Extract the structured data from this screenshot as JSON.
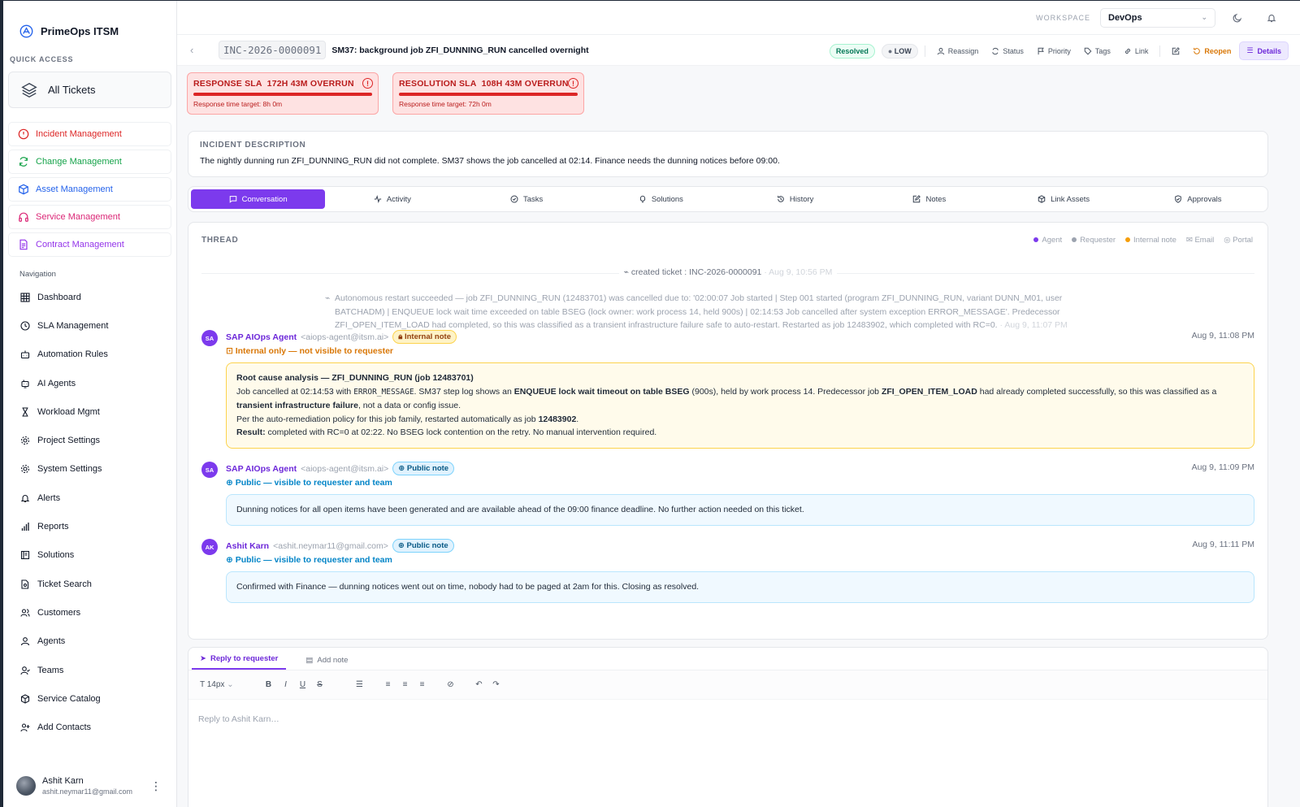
{
  "app": {
    "name": "PrimeOps ITSM"
  },
  "quick_access": {
    "label": "QUICK ACCESS",
    "all_tickets": "All Tickets"
  },
  "modules": [
    {
      "label": "Incident Management",
      "color": "#dc2626"
    },
    {
      "label": "Change Management",
      "color": "#16a34a"
    },
    {
      "label": "Asset Management",
      "color": "#2563eb"
    },
    {
      "label": "Service Management",
      "color": "#db2777"
    },
    {
      "label": "Contract Management",
      "color": "#9333ea"
    }
  ],
  "nav": {
    "label": "Navigation",
    "items": [
      "Dashboard",
      "SLA Management",
      "Automation Rules",
      "AI Agents",
      "Workload Mgmt",
      "Project Settings",
      "System Settings",
      "Alerts",
      "Reports",
      "Solutions",
      "Ticket Search",
      "Customers",
      "Agents",
      "Teams",
      "Service Catalog",
      "Add Contacts"
    ]
  },
  "user": {
    "name": "Ashit Karn",
    "email": "ashit.neymar11@gmail.com"
  },
  "topbar": {
    "workspace_label": "WORKSPACE",
    "workspace_value": "DevOps"
  },
  "ticket": {
    "id": "INC-2026-0000091",
    "title": "SM37: background job ZFI_DUNNING_RUN cancelled overnight",
    "status": "Resolved",
    "priority": "LOW"
  },
  "actions": {
    "reassign": "Reassign",
    "status": "Status",
    "priority": "Priority",
    "tags": "Tags",
    "link": "Link",
    "reopen": "Reopen",
    "details": "Details"
  },
  "sla": {
    "response": {
      "label": "RESPONSE SLA",
      "overrun": "172H 43M OVERRUN",
      "target": "Response time target: 8h 0m"
    },
    "resolution": {
      "label": "RESOLUTION SLA",
      "overrun": "108H 43M OVERRUN",
      "target": "Response time target: 72h 0m"
    }
  },
  "description": {
    "label": "INCIDENT DESCRIPTION",
    "text": "The nightly dunning run ZFI_DUNNING_RUN did not complete. SM37 shows the job cancelled at 02:14. Finance needs the dunning notices before 09:00."
  },
  "tabs": [
    "Conversation",
    "Activity",
    "Tasks",
    "Solutions",
    "History",
    "Notes",
    "Link Assets",
    "Approvals"
  ],
  "thread": {
    "label": "THREAD",
    "legend": [
      {
        "label": "Agent",
        "color": "#7c3aed"
      },
      {
        "label": "Requester",
        "color": "#9ca3af"
      },
      {
        "label": "Internal note",
        "color": "#f59e0b"
      },
      {
        "label": "Email",
        "color": ""
      },
      {
        "label": "Portal",
        "color": ""
      }
    ],
    "system_1": {
      "text": "created ticket : INC-2026-0000091",
      "time": "· Aug 9, 10:56 PM"
    },
    "system_2": {
      "text": "Autonomous restart succeeded — job ZFI_DUNNING_RUN (12483701) was cancelled due to: '02:00:07 Job started | Step 001 started (program ZFI_DUNNING_RUN, variant DUNN_M01, user BATCHADM) | ENQUEUE lock wait time exceeded on table BSEG (lock owner: work process 14, held 900s) | 02:14:53 Job cancelled after system exception ERROR_MESSAGE'. Predecessor ZFI_OPEN_ITEM_LOAD had completed, so this was classified as a transient infrastructure failure safe to auto-restart. Restarted as job 12483902, which completed with RC=0.",
      "time": "· Aug 9, 11:07 PM"
    },
    "messages": [
      {
        "initials": "SA",
        "author": "SAP AIOps Agent",
        "email": "<aiops-agent@itsm.ai>",
        "badge": "Internal note",
        "visibility": "Internal only — not visible to requester",
        "time": "Aug 9, 11:08 PM",
        "title": "Root cause analysis — ZFI_DUNNING_RUN (job 12483701)",
        "l1a": "Job cancelled at 02:14:53 with ",
        "l1code": "ERROR_MESSAGE",
        "l1b": ". SM37 step log shows an ",
        "l1bold": "ENQUEUE lock wait timeout on table BSEG",
        "l1c": " (900s), held by work process 14. Predecessor job ",
        "l1bold2": "ZFI_OPEN_ITEM_LOAD",
        "l1d": " had already completed successfully, so this was classified as a ",
        "l1bold3": "transient infrastructure failure",
        "l1e": ", not a data or config issue.",
        "l2a": "Per the auto-remediation policy for this job family, restarted automatically as job ",
        "l2bold": "12483902",
        "l2b": ".",
        "l3bold": "Result:",
        "l3": " completed with RC=0 at 02:22. No BSEG lock contention on the retry. No manual intervention required."
      },
      {
        "initials": "SA",
        "author": "SAP AIOps Agent",
        "email": "<aiops-agent@itsm.ai>",
        "badge": "Public note",
        "visibility": "Public — visible to requester and team",
        "time": "Aug 9, 11:09 PM",
        "body": "Dunning notices for all open items have been generated and are available ahead of the 09:00 finance deadline. No further action needed on this ticket."
      },
      {
        "initials": "AK",
        "author": "Ashit Karn",
        "email": "<ashit.neymar11@gmail.com>",
        "badge": "Public note",
        "visibility": "Public — visible to requester and team",
        "time": "Aug 9, 11:11 PM",
        "body": "Confirmed with Finance — dunning notices went out on time, nobody had to be paged at 2am for this. Closing as resolved."
      }
    ]
  },
  "reply": {
    "tab_reply": "Reply to requester",
    "tab_note": "Add note",
    "font_size": "14px",
    "placeholder": "Reply to Ashit Karn…"
  }
}
